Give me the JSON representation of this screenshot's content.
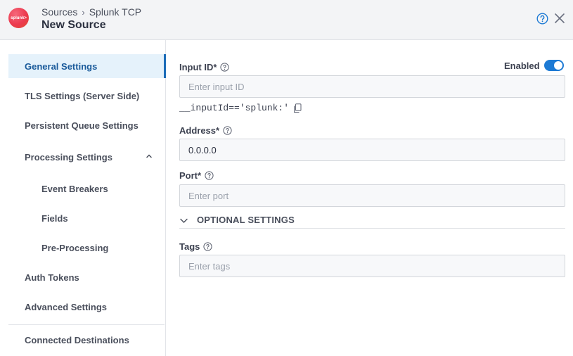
{
  "header": {
    "logo_text": "splunk>",
    "breadcrumb_root": "Sources",
    "breadcrumb_separator": "›",
    "breadcrumb_current": "Splunk TCP",
    "title": "New Source"
  },
  "sidebar": {
    "items": [
      {
        "label": "General Settings",
        "active": true
      },
      {
        "label": "TLS Settings (Server Side)"
      },
      {
        "label": "Persistent Queue Settings"
      },
      {
        "label": "Processing Settings",
        "expanded": true
      },
      {
        "label": "Event Breakers"
      },
      {
        "label": "Fields"
      },
      {
        "label": "Pre-Processing"
      },
      {
        "label": "Auth Tokens"
      },
      {
        "label": "Advanced Settings"
      },
      {
        "label": "Connected Destinations"
      }
    ]
  },
  "form": {
    "input_id": {
      "label": "Input ID*",
      "placeholder": "Enter input ID",
      "value": ""
    },
    "enabled": {
      "label": "Enabled",
      "on": true
    },
    "input_id_expression": "__inputId=='splunk:'",
    "address": {
      "label": "Address*",
      "value": "0.0.0.0"
    },
    "port": {
      "label": "Port*",
      "placeholder": "Enter port",
      "value": ""
    },
    "optional_settings": "OPTIONAL SETTINGS",
    "tags": {
      "label": "Tags",
      "placeholder": "Enter tags",
      "value": ""
    }
  },
  "colors": {
    "accent": "#1d7ad4",
    "active_nav_bg": "#e5f2fb",
    "logo": "#ec3a4f"
  },
  "icons": [
    "help-icon",
    "close-icon",
    "copy-icon",
    "chevron-up-icon",
    "chevron-down-icon"
  ]
}
